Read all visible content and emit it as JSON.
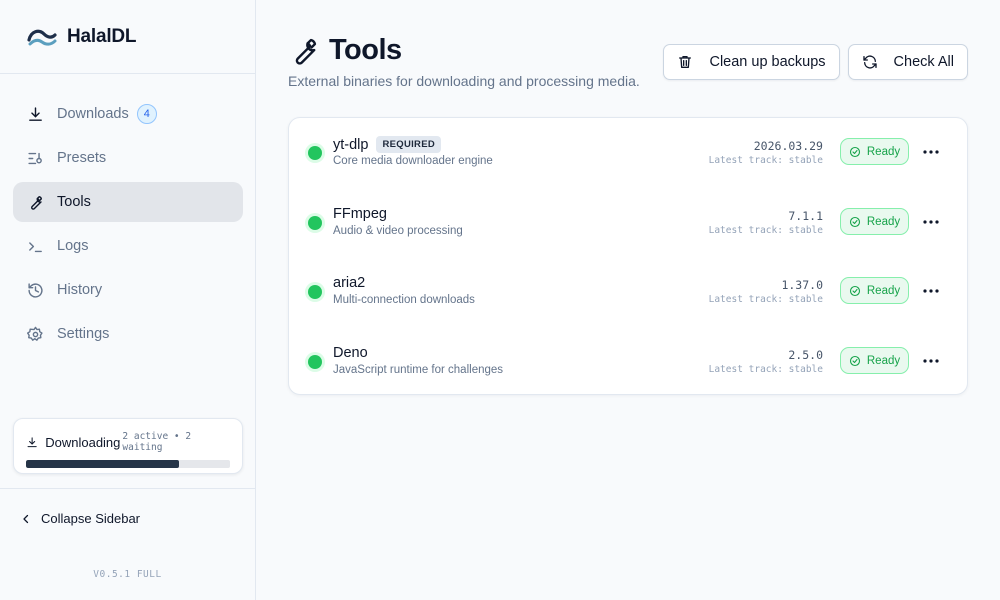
{
  "app": {
    "name": "HalalDL",
    "version": "V0.5.1 FULL"
  },
  "sidebar": {
    "items": [
      {
        "label": "Downloads",
        "icon": "download-icon",
        "badge": "4"
      },
      {
        "label": "Presets",
        "icon": "presets-icon"
      },
      {
        "label": "Tools",
        "icon": "wrench-icon",
        "active": true
      },
      {
        "label": "Logs",
        "icon": "terminal-icon"
      },
      {
        "label": "History",
        "icon": "history-icon"
      },
      {
        "label": "Settings",
        "icon": "gear-icon"
      }
    ],
    "downloading": {
      "title": "Downloading",
      "meta": "2 active • 2 waiting",
      "progress": 0.75
    },
    "collapse_label": "Collapse Sidebar"
  },
  "page": {
    "title": "Tools",
    "subtitle": "External binaries for downloading and processing media.",
    "actions": {
      "cleanup_label": "Clean up backups",
      "check_all_label": "Check All"
    }
  },
  "tools": [
    {
      "name": "yt-dlp",
      "tag": "REQUIRED",
      "description": "Core media downloader engine",
      "version": "2026.03.29",
      "track": "Latest track: stable",
      "status": "Ready"
    },
    {
      "name": "FFmpeg",
      "description": "Audio & video processing",
      "version": "7.1.1",
      "track": "Latest track: stable",
      "status": "Ready"
    },
    {
      "name": "aria2",
      "description": "Multi-connection downloads",
      "version": "1.37.0",
      "track": "Latest track: stable",
      "status": "Ready"
    },
    {
      "name": "Deno",
      "description": "JavaScript runtime for challenges",
      "version": "2.5.0",
      "track": "Latest track: stable",
      "status": "Ready"
    }
  ],
  "colors": {
    "accent": "#0f172a",
    "ready_green": "#22c55e",
    "progress": "#253447",
    "badge_blue": "#2563eb"
  }
}
